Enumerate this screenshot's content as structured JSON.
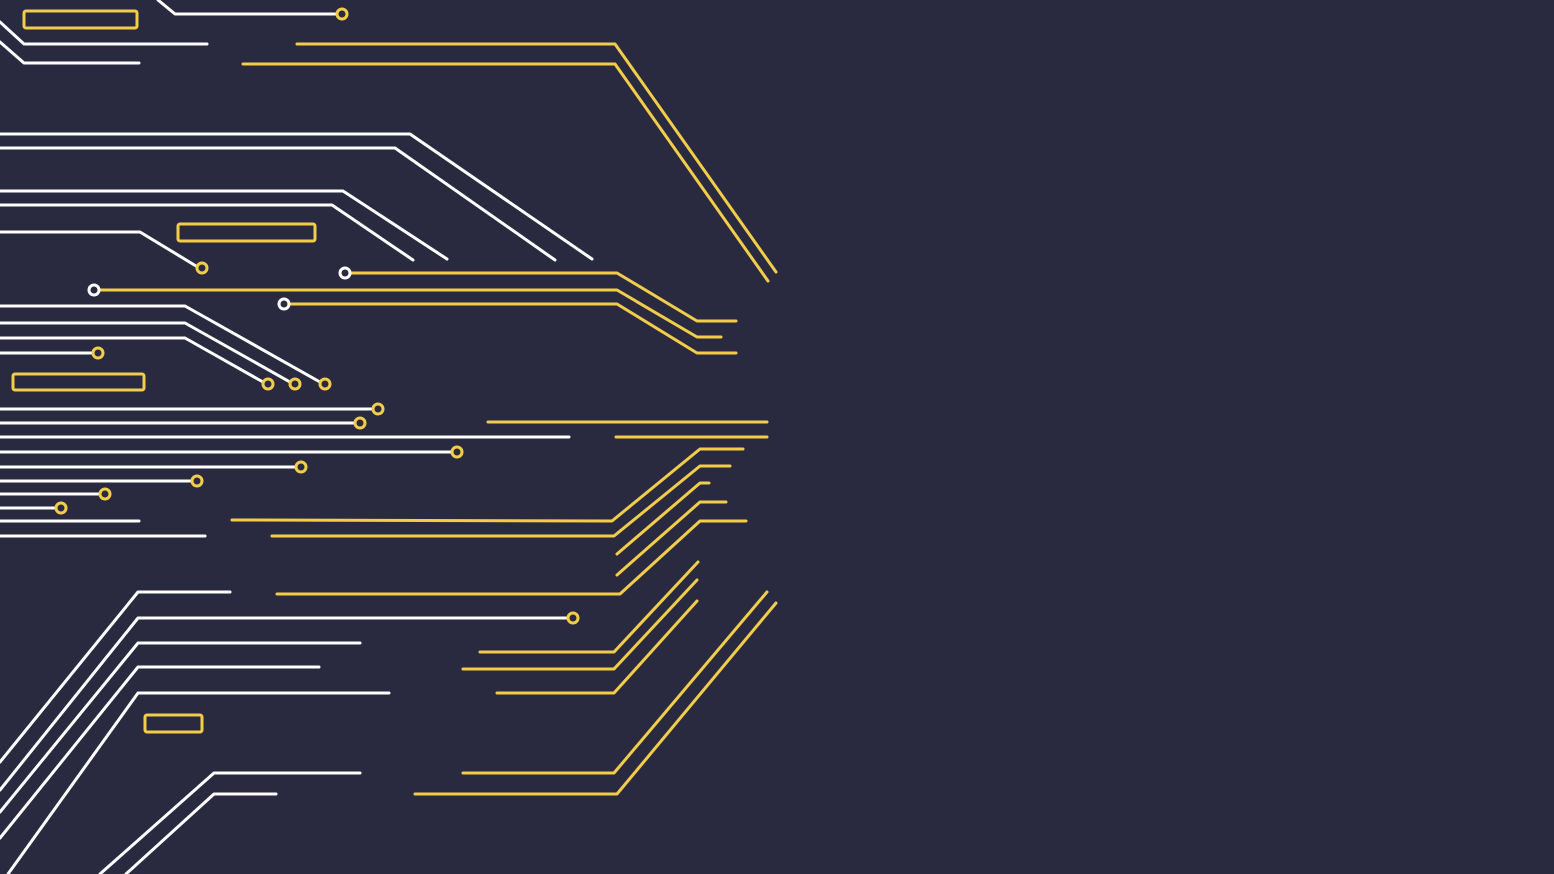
{
  "colors": {
    "background": "#292a40",
    "white_trace": "#ffffff",
    "gold_trace": "#f2cd4a"
  }
}
